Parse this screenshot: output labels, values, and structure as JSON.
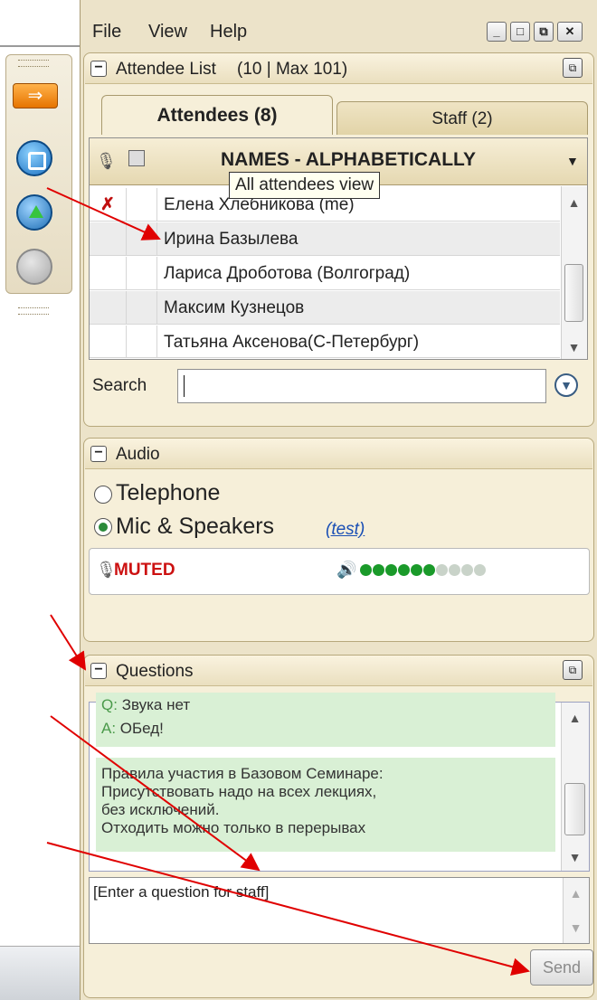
{
  "menu": {
    "file": "File",
    "view": "View",
    "help": "Help"
  },
  "attendee_section": {
    "title": "Attendee List",
    "count_text": "(10 | Max 101)",
    "tabs": [
      {
        "label": "Attendees (8)"
      },
      {
        "label": "Staff (2)"
      }
    ],
    "sort_header": "NAMES - ALPHABETICALLY",
    "tooltip": "All attendees view",
    "rows": [
      {
        "name": "Елена Хлебникова (me)"
      },
      {
        "name": "Ирина Базылева"
      },
      {
        "name": "Лариса Дроботова (Волгоград)"
      },
      {
        "name": "Максим Кузнецов"
      },
      {
        "name": "Татьяна Аксенова(С-Петербург)"
      }
    ],
    "search_label": "Search",
    "search_value": ""
  },
  "audio_section": {
    "title": "Audio",
    "option_telephone": "Telephone",
    "option_mic": "Mic & Speakers",
    "test_link": "(test)",
    "status": "MUTED",
    "level_total": 10,
    "level_lit": 6,
    "colors": {
      "muted": "#cc1111",
      "level_on": "#1a9a2a",
      "level_off": "#c9d3c9"
    }
  },
  "questions_section": {
    "title": "Questions",
    "qa": {
      "q_prefix": "Q:",
      "q_text": "Звука нет",
      "a_prefix": "A:",
      "a_text": "ОБед!"
    },
    "message_lines": [
      "Правила участия в Базовом Семинаре:",
      "Присутствовать надо на всех лекциях,",
      "без исключений.",
      "Отходить можно только в перерывах"
    ],
    "input_placeholder": "[Enter a question for staff]",
    "send_label": "Send"
  },
  "colors": {
    "panel_bg": "#ece3c9",
    "annotation_arrow": "#e00000"
  }
}
